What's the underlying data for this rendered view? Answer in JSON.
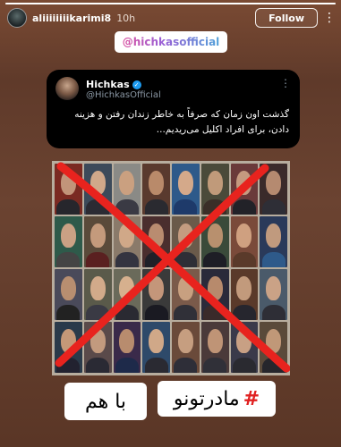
{
  "story": {
    "progress_fraction": 1.0,
    "username": "aliiiiiiiikarimi8",
    "time": "10h",
    "follow_label": "Follow",
    "more_label": "⋮",
    "mention_sticker": "@hichkasofficial"
  },
  "tweet": {
    "name": "Hichkas",
    "handle": "@HichkasOfficial",
    "more_label": "⋮",
    "text": "گذشت اون زمان که صرفاً به خاطر زندان رفتن و هزینه دادن، برای افراد اکلیل می‌ریدیم..."
  },
  "stickers": {
    "together": "با هم",
    "hashtag_symbol": "#",
    "hashtag_word": "مادرتونو"
  },
  "colors": {
    "background": "#6b4331",
    "cross": "#e8231e",
    "verified": "#1d9bf0",
    "hashtag": "#e02020"
  }
}
